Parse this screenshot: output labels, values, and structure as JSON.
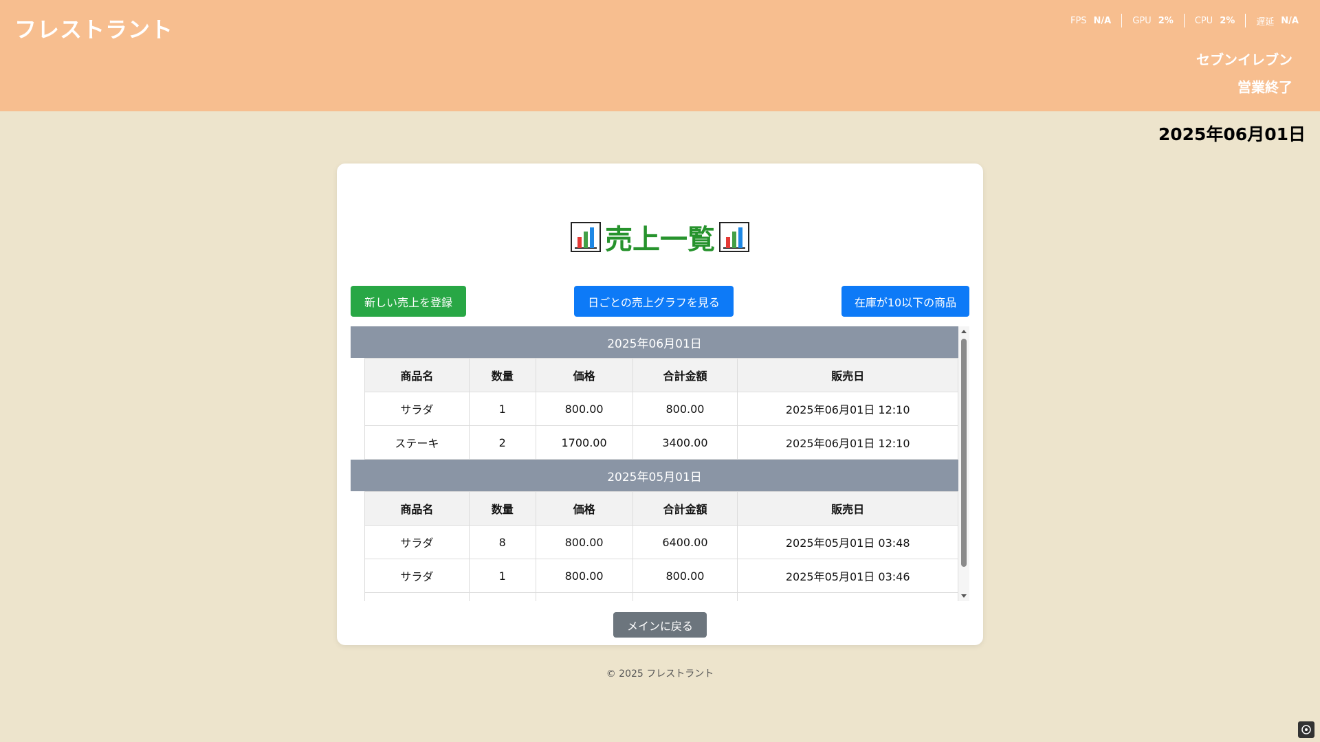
{
  "header": {
    "brand": "フレストラント",
    "stats": [
      {
        "label": "FPS",
        "value": "N/A"
      },
      {
        "label": "GPU",
        "value": "2%"
      },
      {
        "label": "CPU",
        "value": "2%"
      },
      {
        "label": "遅延",
        "value": "N/A"
      }
    ],
    "store": "セブンイレブン",
    "status": "営業終了"
  },
  "current_date": "2025年06月01日",
  "page": {
    "title": "売上一覧",
    "icon": "bar-chart-icon",
    "buttons": {
      "new_sale": "新しい売上を登録",
      "daily_graph": "日ごとの売上グラフを見る",
      "low_stock": "在庫が10以下の商品"
    },
    "back": "メインに戻る"
  },
  "table": {
    "headers": [
      "商品名",
      "数量",
      "価格",
      "合計金額",
      "販売日"
    ],
    "groups": [
      {
        "date": "2025年06月01日",
        "rows": [
          [
            "サラダ",
            "1",
            "800.00",
            "800.00",
            "2025年06月01日 12:10"
          ],
          [
            "ステーキ",
            "2",
            "1700.00",
            "3400.00",
            "2025年06月01日 12:10"
          ]
        ]
      },
      {
        "date": "2025年05月01日",
        "rows": [
          [
            "サラダ",
            "8",
            "800.00",
            "6400.00",
            "2025年05月01日 03:48"
          ],
          [
            "サラダ",
            "1",
            "800.00",
            "800.00",
            "2025年05月01日 03:46"
          ]
        ]
      }
    ]
  },
  "footer": "© 2025 フレストラント",
  "colors": {
    "header": "#f7be8f",
    "background": "#ede4cc",
    "title": "#27932d",
    "green_button": "#28a745",
    "blue_button": "#0d7af7",
    "group_header": "#8a95a5",
    "back_button": "#6c757d"
  }
}
